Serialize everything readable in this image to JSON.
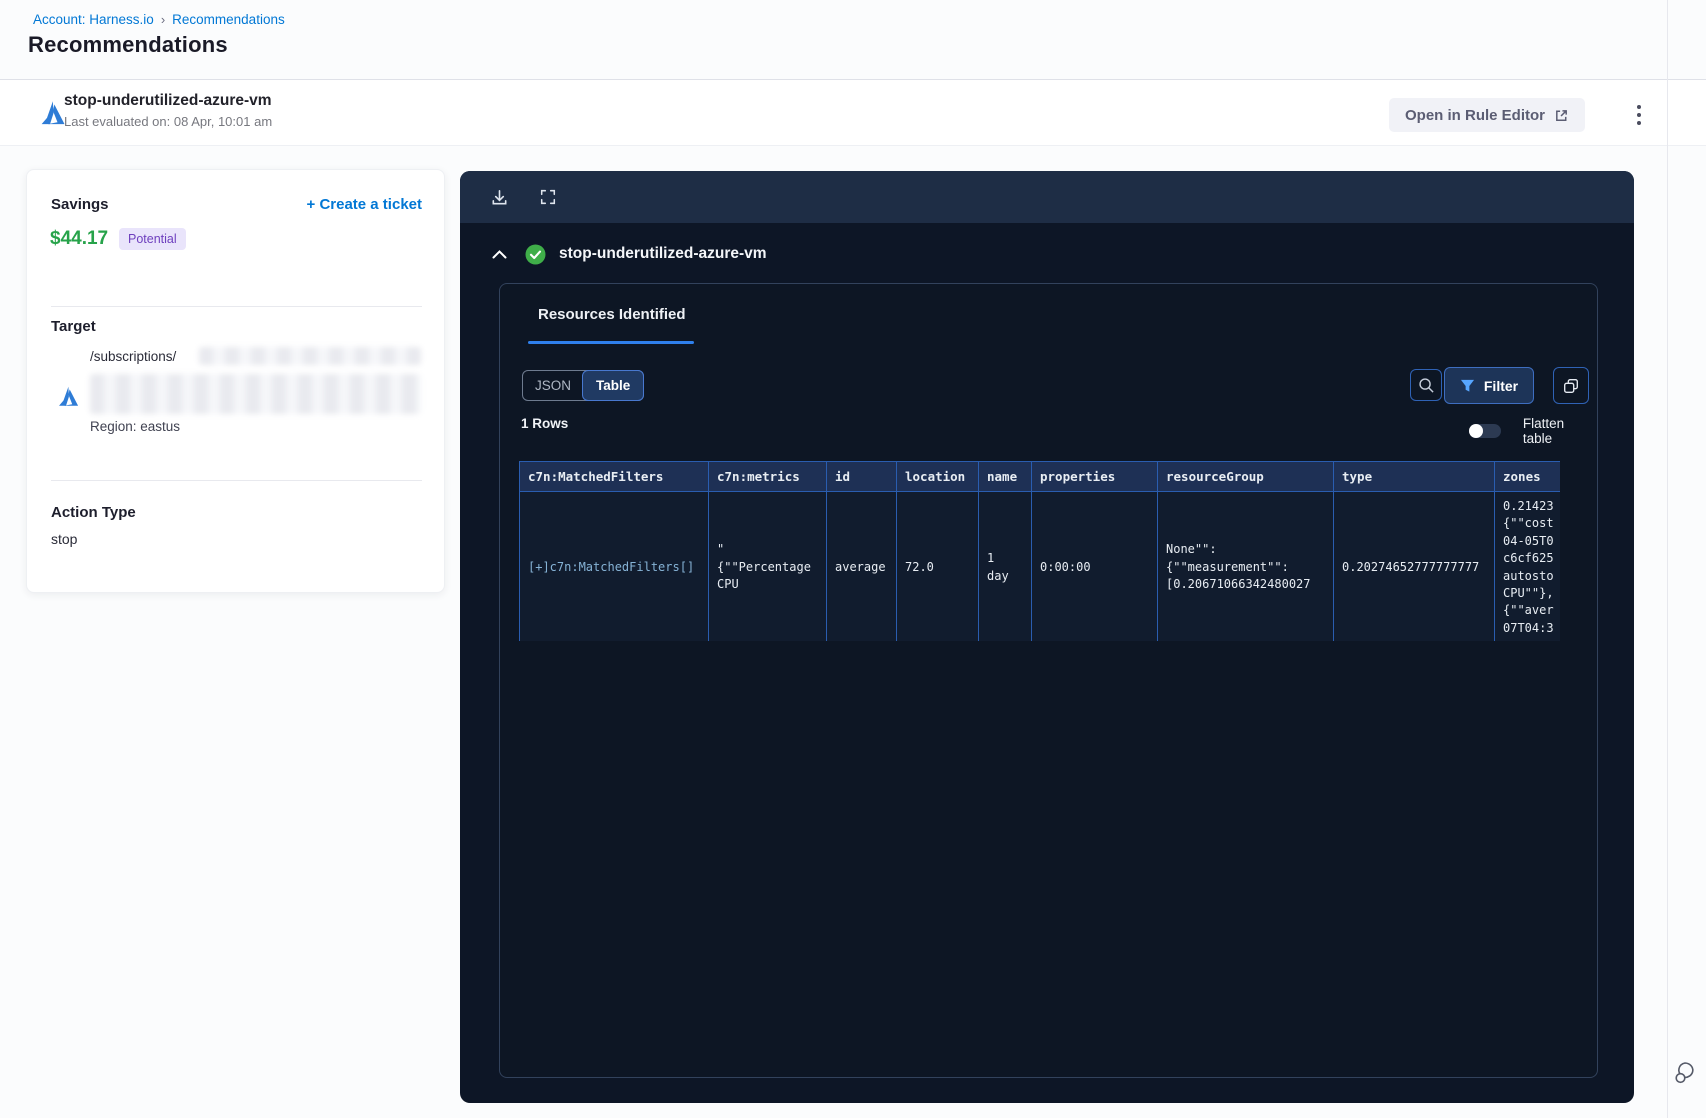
{
  "breadcrumb": {
    "account": "Account: Harness.io",
    "separator": "›",
    "current": "Recommendations"
  },
  "page": {
    "title": "Recommendations"
  },
  "header": {
    "name": "stop-underutilized-azure-vm",
    "last_evaluated": "Last evaluated on: 08 Apr, 10:01 am",
    "open_rule_editor_label": "Open in Rule Editor"
  },
  "savings": {
    "label": "Savings",
    "amount": "$44.17",
    "badge": "Potential",
    "create_ticket_label": "+ Create a ticket"
  },
  "target": {
    "label": "Target",
    "path": "/subscriptions/",
    "region": "Region: eastus"
  },
  "action": {
    "label": "Action Type",
    "value": "stop"
  },
  "panel": {
    "title": "stop-underutilized-azure-vm",
    "tab_label": "Resources Identified",
    "view_toggle": {
      "json": "JSON",
      "table": "Table"
    },
    "filter_label": "Filter",
    "rows_count": "1 Rows",
    "flatten_label": "Flatten table"
  },
  "table": {
    "columns": [
      "c7n:MatchedFilters",
      "c7n:metrics",
      "id",
      "location",
      "name",
      "properties",
      "resourceGroup",
      "type",
      "zones"
    ],
    "rows": [
      [
        "[+]c7n:MatchedFilters[]",
        "\"\n{\"\"Percentage\nCPU",
        "average",
        "72.0",
        "1\nday",
        "0:00:00",
        "None\"\":\n{\"\"measurement\"\":\n[0.20671066342480027",
        "0.20274652777777777",
        "0.21423\n{\"\"cost\n04-05T0\nc6cf625\nautosto\nCPU\"\"},\n{\"\"aver\n07T04:3"
      ]
    ]
  },
  "colors": {
    "accent_blue": "#0278d5",
    "savings_green": "#27a34a",
    "badge_bg": "#e9e4fb",
    "badge_text": "#6e3fbe",
    "panel_bg": "#0d1626",
    "panel_topbar": "#1e2d45",
    "table_border": "#2a5db0",
    "table_header_bg": "#1e3055",
    "tab_underline": "#2f80ed",
    "check_green": "#3fae49",
    "azure_blue": "#2e7cd6"
  }
}
